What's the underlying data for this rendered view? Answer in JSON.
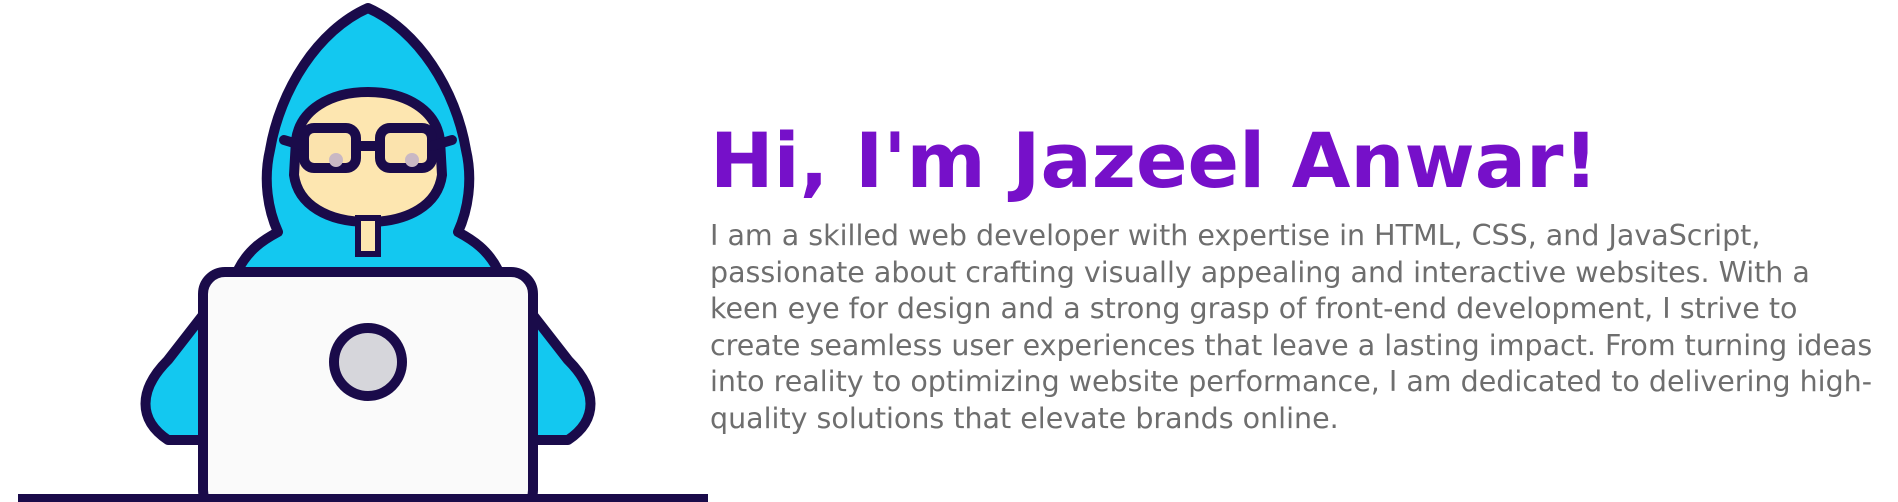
{
  "hero": {
    "greeting": "Hi, I'm Jazeel Anwar!",
    "bio": "I am a skilled web developer with expertise in HTML, CSS, and JavaScript, passionate about crafting visually appealing and interactive websites. With a keen eye for design and a strong grasp of front-end development, I strive to create seamless user experiences that leave a lasting impact. From turning ideas into reality to optimizing website performance, I am dedicated to delivering high-quality solutions that elevate brands online."
  },
  "illustration": {
    "icon": "hooded-developer-at-laptop",
    "colors": {
      "hood": "#13c8f0",
      "outline": "#1a0b4a",
      "face": "#fde6b0",
      "laptop": "#fafafa",
      "logo": "#d6d6db",
      "glasses_lens": "#fbe3ad"
    }
  },
  "theme": {
    "heading_color": "#7610c9",
    "body_text_color": "#6e6e6e",
    "background": "#ffffff"
  }
}
